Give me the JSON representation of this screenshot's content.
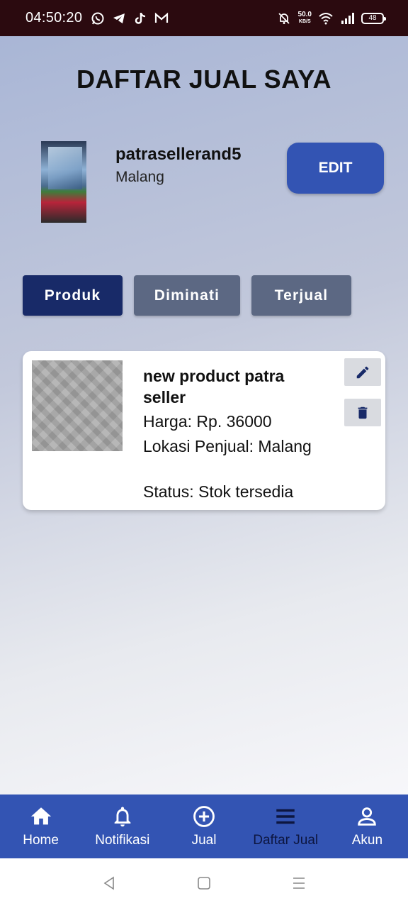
{
  "status_bar": {
    "time": "04:50:20",
    "speed_value": "50.0",
    "speed_unit": "KB/S",
    "battery": "48",
    "left_icons": [
      "whatsapp-icon",
      "telegram-icon",
      "tiktok-icon",
      "gmail-icon"
    ],
    "right_icons": [
      "mute-bell-icon",
      "wifi-icon",
      "signal-icon",
      "battery-icon"
    ]
  },
  "header": {
    "title": "DAFTAR JUAL SAYA"
  },
  "profile": {
    "name": "patrasellerand5",
    "city": "Malang",
    "edit_label": "EDIT"
  },
  "tabs": [
    {
      "label": "Produk",
      "active": true
    },
    {
      "label": "Diminati",
      "active": false
    },
    {
      "label": "Terjual",
      "active": false
    }
  ],
  "products": [
    {
      "name": "new product patra seller",
      "price": "Harga: Rp. 36000",
      "location": "Lokasi Penjual: Malang",
      "status": "Status: Stok tersedia"
    }
  ],
  "bottom_nav": [
    {
      "label": "Home",
      "icon": "home-icon",
      "active": false
    },
    {
      "label": "Notifikasi",
      "icon": "bell-icon",
      "active": false
    },
    {
      "label": "Jual",
      "icon": "plus-circle-icon",
      "active": false
    },
    {
      "label": "Daftar Jual",
      "icon": "menu-icon",
      "active": true
    },
    {
      "label": "Akun",
      "icon": "person-icon",
      "active": false
    }
  ],
  "colors": {
    "primary": "#3354b3",
    "tab_active": "#182a68",
    "tab_inactive": "#5c6883",
    "status_bar": "#2b0a0f"
  }
}
